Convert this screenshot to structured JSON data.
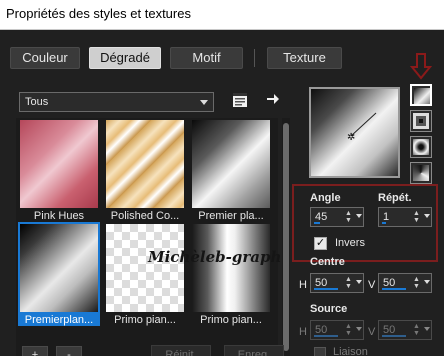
{
  "window": {
    "title": "Propriétés des styles et textures"
  },
  "tabs": [
    {
      "label": "Couleur",
      "active": false
    },
    {
      "label": "Dégradé",
      "active": true
    },
    {
      "label": "Motif",
      "active": false
    },
    {
      "label": "Texture",
      "active": false
    }
  ],
  "category": {
    "selected": "Tous"
  },
  "gallery": {
    "items": [
      {
        "label": "Pink Hues",
        "selected": false
      },
      {
        "label": "Polished Co...",
        "selected": false
      },
      {
        "label": "Premier pla...",
        "selected": false
      },
      {
        "label": "Premierplan...",
        "selected": true
      },
      {
        "label": "Primo pian...",
        "selected": false
      },
      {
        "label": "Primo pian...",
        "selected": false
      }
    ]
  },
  "gradient": {
    "angle_label": "Angle",
    "angle_value": "45",
    "repeat_label": "Répét.",
    "repeat_value": "1",
    "invert_label": "Invers",
    "invert_checked": true,
    "center_label": "Centre",
    "center_h_label": "H",
    "center_h_value": "50",
    "center_v_label": "V",
    "center_v_value": "50",
    "source_label": "Source",
    "source_h_label": "H",
    "source_h_value": "50",
    "source_v_label": "V",
    "source_v_value": "50",
    "link_label": "Liaison"
  },
  "buttons": {
    "add_label": "+",
    "remove_label": "-",
    "reset_label": "Réinit.",
    "save_label": "Enreg."
  },
  "watermark": {
    "text": "Michèleb-graph"
  },
  "colors": {
    "accent": "#1979d4",
    "highlight_box": "#7b1e1e",
    "arrow_marker": "#8b1a1a"
  }
}
